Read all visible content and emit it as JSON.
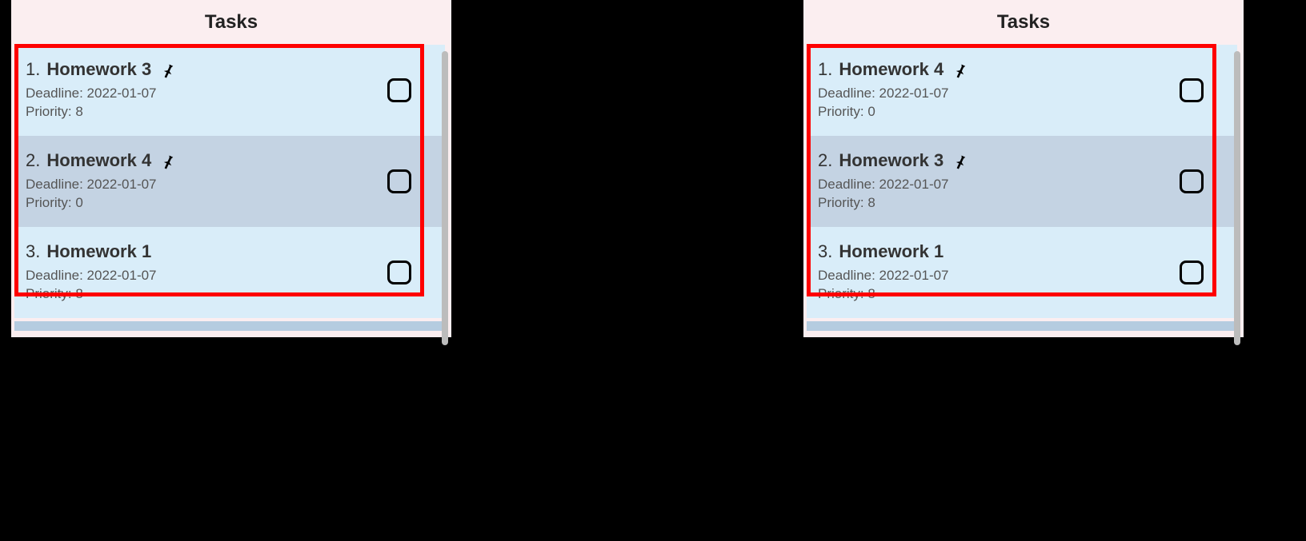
{
  "panels": {
    "left": {
      "title": "Tasks",
      "highlighted": true,
      "tasks": [
        {
          "index": "1.",
          "title": "Homework 3",
          "pinned": true,
          "deadline": "Deadline: 2022-01-07",
          "priority": "Priority: 8",
          "shade": "light"
        },
        {
          "index": "2.",
          "title": "Homework 4",
          "pinned": true,
          "deadline": "Deadline: 2022-01-07",
          "priority": "Priority: 0",
          "shade": "dark"
        },
        {
          "index": "3.",
          "title": "Homework 1",
          "pinned": false,
          "deadline": "Deadline: 2022-01-07",
          "priority": "Priority: 8",
          "shade": "light"
        }
      ]
    },
    "right": {
      "title": "Tasks",
      "highlighted": true,
      "tasks": [
        {
          "index": "1.",
          "title": "Homework 4",
          "pinned": true,
          "deadline": "Deadline: 2022-01-07",
          "priority": "Priority: 0",
          "shade": "light"
        },
        {
          "index": "2.",
          "title": "Homework 3",
          "pinned": true,
          "deadline": "Deadline: 2022-01-07",
          "priority": "Priority: 8",
          "shade": "dark"
        },
        {
          "index": "3.",
          "title": "Homework 1",
          "pinned": false,
          "deadline": "Deadline: 2022-01-07",
          "priority": "Priority: 8",
          "shade": "light"
        }
      ]
    }
  }
}
